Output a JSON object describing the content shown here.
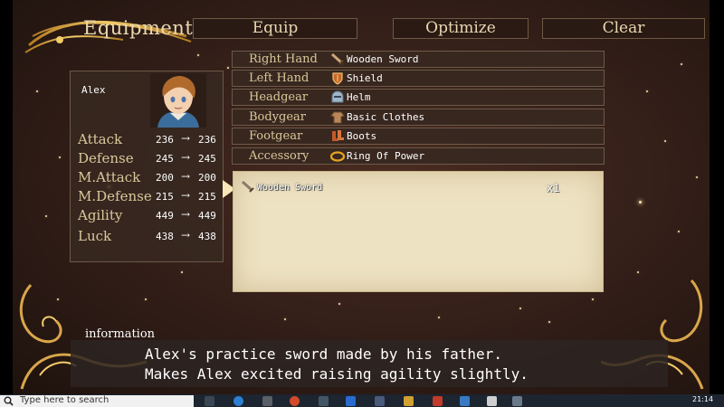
{
  "header": {
    "title": "Equipment",
    "commands": [
      "Equip",
      "Optimize",
      "Clear"
    ]
  },
  "actor": {
    "name": "Alex",
    "stats": [
      {
        "label": "Attack",
        "current": "236",
        "new": "236"
      },
      {
        "label": "Defense",
        "current": "245",
        "new": "245"
      },
      {
        "label": "M.Attack",
        "current": "200",
        "new": "200"
      },
      {
        "label": "M.Defense",
        "current": "215",
        "new": "215"
      },
      {
        "label": "Agility",
        "current": "449",
        "new": "449"
      },
      {
        "label": "Luck",
        "current": "438",
        "new": "438"
      }
    ],
    "arrow": "→"
  },
  "slots": [
    {
      "label": "Right Hand",
      "item": "Wooden Sword",
      "icon": "sword-icon"
    },
    {
      "label": "Left Hand",
      "item": "Shield",
      "icon": "shield-icon"
    },
    {
      "label": "Headgear",
      "item": "Helm",
      "icon": "helm-icon"
    },
    {
      "label": "Bodygear",
      "item": "Basic Clothes",
      "icon": "clothes-icon"
    },
    {
      "label": "Footgear",
      "item": "Boots",
      "icon": "boots-icon"
    },
    {
      "label": "Accessory",
      "item": "Ring Of Power",
      "icon": "ring-icon"
    }
  ],
  "item_list": {
    "items": [
      {
        "name": "Wooden Sword",
        "count": "x1",
        "icon": "sword-icon"
      }
    ]
  },
  "information": {
    "label": "information",
    "lines": [
      "Alex's practice sword made by his father.",
      "Makes Alex excited raising agility slightly."
    ]
  },
  "taskbar": {
    "search_placeholder": "Type here to search",
    "clock": "21:14"
  },
  "colors": {
    "label_gold": "#d9c89a",
    "panel_bg": "#372820",
    "list_bg": "#ede2c2"
  }
}
